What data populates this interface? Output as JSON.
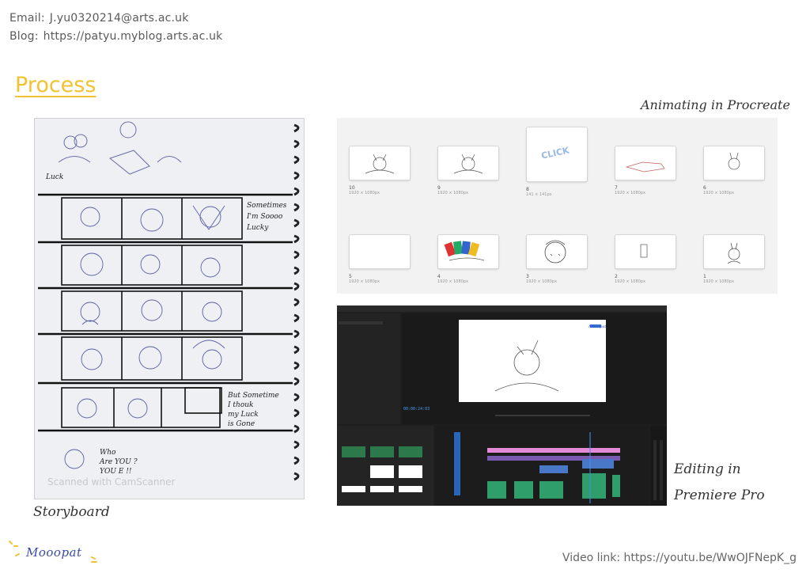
{
  "contact": {
    "email_label": "Email:",
    "email": "J.yu0320214@arts.ac.uk",
    "blog_label": "Blog:",
    "blog": "https://patyu.myblog.arts.ac.uk"
  },
  "title": "Process",
  "storyboard": {
    "label": "Storyboard",
    "watermark": "Scanned with CamScanner",
    "sketch_text": [
      "Luck",
      "Sometimes",
      "I'm Soooo",
      "Lucky",
      "But Sometime",
      "I thouk",
      "my Luck",
      "is Gone",
      "Who",
      "Are YOU ?",
      "YOU E !!"
    ]
  },
  "procreate": {
    "label": "Animating in Procreate",
    "frames": [
      {
        "num": "10",
        "size": "1920 × 1080px"
      },
      {
        "num": "9",
        "size": "1920 × 1080px"
      },
      {
        "num": "8",
        "size": "141 × 141px"
      },
      {
        "num": "7",
        "size": "1920 × 1080px"
      },
      {
        "num": "6",
        "size": "1920 × 1080px"
      },
      {
        "num": "5",
        "size": "1920 × 1080px"
      },
      {
        "num": "4",
        "size": "1920 × 1080px"
      },
      {
        "num": "3",
        "size": "1920 × 1080px"
      },
      {
        "num": "2",
        "size": "1920 × 1080px"
      },
      {
        "num": "1",
        "size": "1920 × 1080px"
      }
    ],
    "click_word": "CLICK"
  },
  "premiere": {
    "label_line1": "Editing in",
    "label_line2": "Premiere Pro",
    "timecode": "00:00:24:03",
    "brand_mark": "Mooopat"
  },
  "brand": "Mooopat",
  "video_link": "Video link: https://youtu.be/WwOJFNepK_g",
  "colors": {
    "title": "#f2c230",
    "brand": "#3b4ba8",
    "premiere_bg": "#1e1e1e",
    "timeline_pink": "#e58ad8",
    "timeline_green": "#2f9e6a",
    "timeline_blue": "#4a78c8"
  }
}
